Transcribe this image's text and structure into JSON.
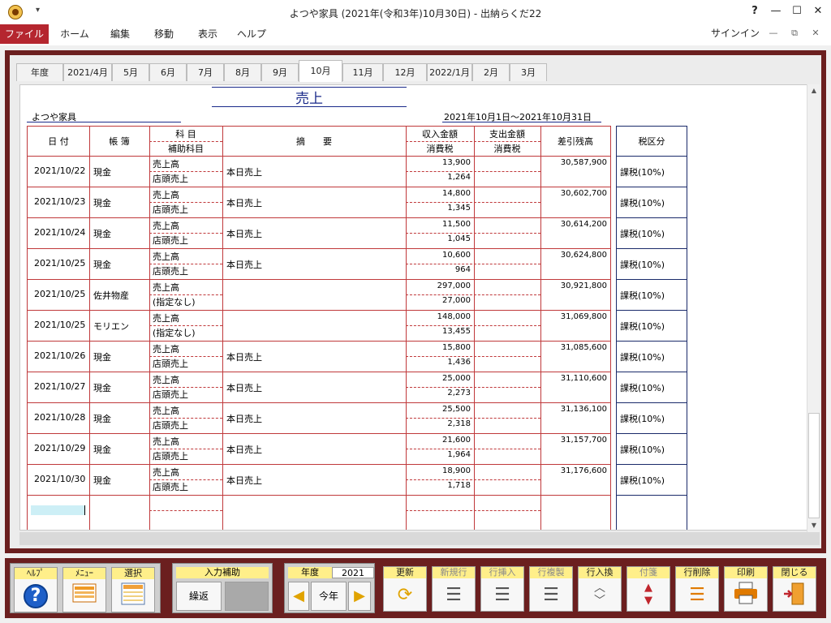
{
  "window": {
    "title": "よつや家具 (2021年(令和3年)10月30日) - 出納らくだ22",
    "qat_icon": "dropdown-icon",
    "help": "?",
    "minimize": "—",
    "maximize": "☐",
    "close": "✕"
  },
  "menu": {
    "items": [
      "ファイル",
      "ホーム",
      "編集",
      "移動",
      "表示",
      "ヘルプ"
    ],
    "signin": "サインイン",
    "sys_min": "—",
    "sys_restore": "⧉",
    "sys_close": "✕"
  },
  "tabs": [
    "年度",
    "2021/4月",
    "5月",
    "6月",
    "7月",
    "8月",
    "9月",
    "10月",
    "11月",
    "12月",
    "2022/1月",
    "2月",
    "3月"
  ],
  "active_tab": "10月",
  "ledger": {
    "title": "売上",
    "company": "よつや家具",
    "period": "2021年10月1日～2021年10月31日",
    "headers": {
      "date": "日 付",
      "book": "帳 簿",
      "account": "科 目",
      "sub_account": "補助科目",
      "summary": "摘　　要",
      "income": "収入金額",
      "income_tax": "消費税",
      "expense": "支出金額",
      "expense_tax": "消費税",
      "balance": "差引残高",
      "tax_class": "税区分"
    },
    "rows": [
      {
        "date": "2021/10/22",
        "book": "現金",
        "account": "売上高",
        "sub": "店頭売上",
        "summary": "本日売上",
        "income": "13,900",
        "tax": "1,264",
        "balance": "30,587,900",
        "tax_class": "課税(10%)"
      },
      {
        "date": "2021/10/23",
        "book": "現金",
        "account": "売上高",
        "sub": "店頭売上",
        "summary": "本日売上",
        "income": "14,800",
        "tax": "1,345",
        "balance": "30,602,700",
        "tax_class": "課税(10%)"
      },
      {
        "date": "2021/10/24",
        "book": "現金",
        "account": "売上高",
        "sub": "店頭売上",
        "summary": "本日売上",
        "income": "11,500",
        "tax": "1,045",
        "balance": "30,614,200",
        "tax_class": "課税(10%)"
      },
      {
        "date": "2021/10/25",
        "book": "現金",
        "account": "売上高",
        "sub": "店頭売上",
        "summary": "本日売上",
        "income": "10,600",
        "tax": "964",
        "balance": "30,624,800",
        "tax_class": "課税(10%)"
      },
      {
        "date": "2021/10/25",
        "book": "佐井物産",
        "account": "売上高",
        "sub": "(指定なし)",
        "summary": "",
        "income": "297,000",
        "tax": "27,000",
        "balance": "30,921,800",
        "tax_class": "課税(10%)"
      },
      {
        "date": "2021/10/25",
        "book": "モリエン",
        "account": "売上高",
        "sub": "(指定なし)",
        "summary": "",
        "income": "148,000",
        "tax": "13,455",
        "balance": "31,069,800",
        "tax_class": "課税(10%)"
      },
      {
        "date": "2021/10/26",
        "book": "現金",
        "account": "売上高",
        "sub": "店頭売上",
        "summary": "本日売上",
        "income": "15,800",
        "tax": "1,436",
        "balance": "31,085,600",
        "tax_class": "課税(10%)"
      },
      {
        "date": "2021/10/27",
        "book": "現金",
        "account": "売上高",
        "sub": "店頭売上",
        "summary": "本日売上",
        "income": "25,000",
        "tax": "2,273",
        "balance": "31,110,600",
        "tax_class": "課税(10%)"
      },
      {
        "date": "2021/10/28",
        "book": "現金",
        "account": "売上高",
        "sub": "店頭売上",
        "summary": "本日売上",
        "income": "25,500",
        "tax": "2,318",
        "balance": "31,136,100",
        "tax_class": "課税(10%)"
      },
      {
        "date": "2021/10/29",
        "book": "現金",
        "account": "売上高",
        "sub": "店頭売上",
        "summary": "本日売上",
        "income": "21,600",
        "tax": "1,964",
        "balance": "31,157,700",
        "tax_class": "課税(10%)"
      },
      {
        "date": "2021/10/30",
        "book": "現金",
        "account": "売上高",
        "sub": "店頭売上",
        "summary": "本日売上",
        "income": "18,900",
        "tax": "1,718",
        "balance": "31,176,600",
        "tax_class": "課税(10%)"
      }
    ]
  },
  "toolbar": {
    "help": "ﾍﾙﾌﾟ",
    "menu": "ﾒﾆｭｰ",
    "select": "選択",
    "input_assist": "入力補助",
    "carry": "繰返",
    "year_label": "年度",
    "year_value": "2021",
    "this_year": "今年",
    "update": "更新",
    "new_row": "新規行",
    "insert_row": "行挿入",
    "copy_row": "行複製",
    "swap_row": "行入換",
    "tag": "付箋",
    "delete_row": "行削除",
    "print": "印刷",
    "close": "閉じる"
  }
}
